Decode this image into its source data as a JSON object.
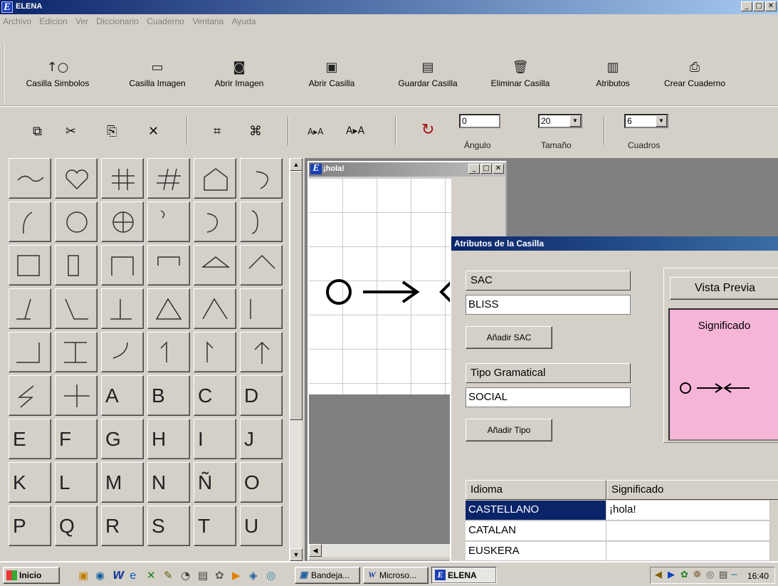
{
  "window": {
    "title": "ELENA",
    "logo_letter": "E"
  },
  "menu": [
    "Archivo",
    "Edicion",
    "Ver",
    "Diccionario",
    "Cuaderno",
    "Ventana",
    "Ayuda"
  ],
  "toolbar": [
    {
      "label": "Casilla Simbolos",
      "icon": "circle-arrow-icon"
    },
    {
      "label": "Casilla Imagen",
      "icon": "window-icon"
    },
    {
      "label": "Abrir Imagen",
      "icon": "camera-icon"
    },
    {
      "label": "Abrir Casilla",
      "icon": "open-box-icon"
    },
    {
      "label": "Guardar Casilla",
      "icon": "save-box-icon"
    },
    {
      "label": "Eliminar Casilla",
      "icon": "trash-icon"
    },
    {
      "label": "Atributos",
      "icon": "attributes-icon"
    },
    {
      "label": "Crear Cuaderno",
      "icon": "printer-icon"
    }
  ],
  "edit_toolbar": {
    "angle_value": "0",
    "angle_label": "Ángulo",
    "size_value": "20",
    "size_label": "Tamaño",
    "cuadros_value": "6",
    "cuadros_label": "Cuadros",
    "font_small": "A▸A",
    "font_large": "A▸A"
  },
  "symbol_letters": [
    "A",
    "B",
    "C",
    "D",
    "E",
    "F",
    "G",
    "H",
    "I",
    "J",
    "K",
    "L",
    "M",
    "N",
    "Ñ",
    "O",
    "P",
    "Q",
    "R",
    "S",
    "T",
    "U"
  ],
  "child_window": {
    "title": "¡hola!",
    "logo_letter": "E"
  },
  "dialog": {
    "title": "Atributos de la Casilla",
    "sac_header": "SAC",
    "sac_value": "BLISS",
    "add_sac": "Añadir SAC",
    "tipo_header": "Tipo Gramatical",
    "tipo_value": "SOCIAL",
    "add_tipo": "Añadir Tipo",
    "preview_button": "Vista Previa",
    "preview_caption": "Significado",
    "table_headers": [
      "Idioma",
      "Significado"
    ],
    "rows": [
      {
        "idioma": "CASTELLANO",
        "significado": "¡hola!"
      },
      {
        "idioma": "CATALAN",
        "significado": ""
      },
      {
        "idioma": "EUSKERA",
        "significado": ""
      }
    ]
  },
  "taskbar": {
    "start": "Inicio",
    "tasks": [
      "Bandeja...",
      "Microso...",
      "ELENA"
    ],
    "clock": "16:40"
  }
}
